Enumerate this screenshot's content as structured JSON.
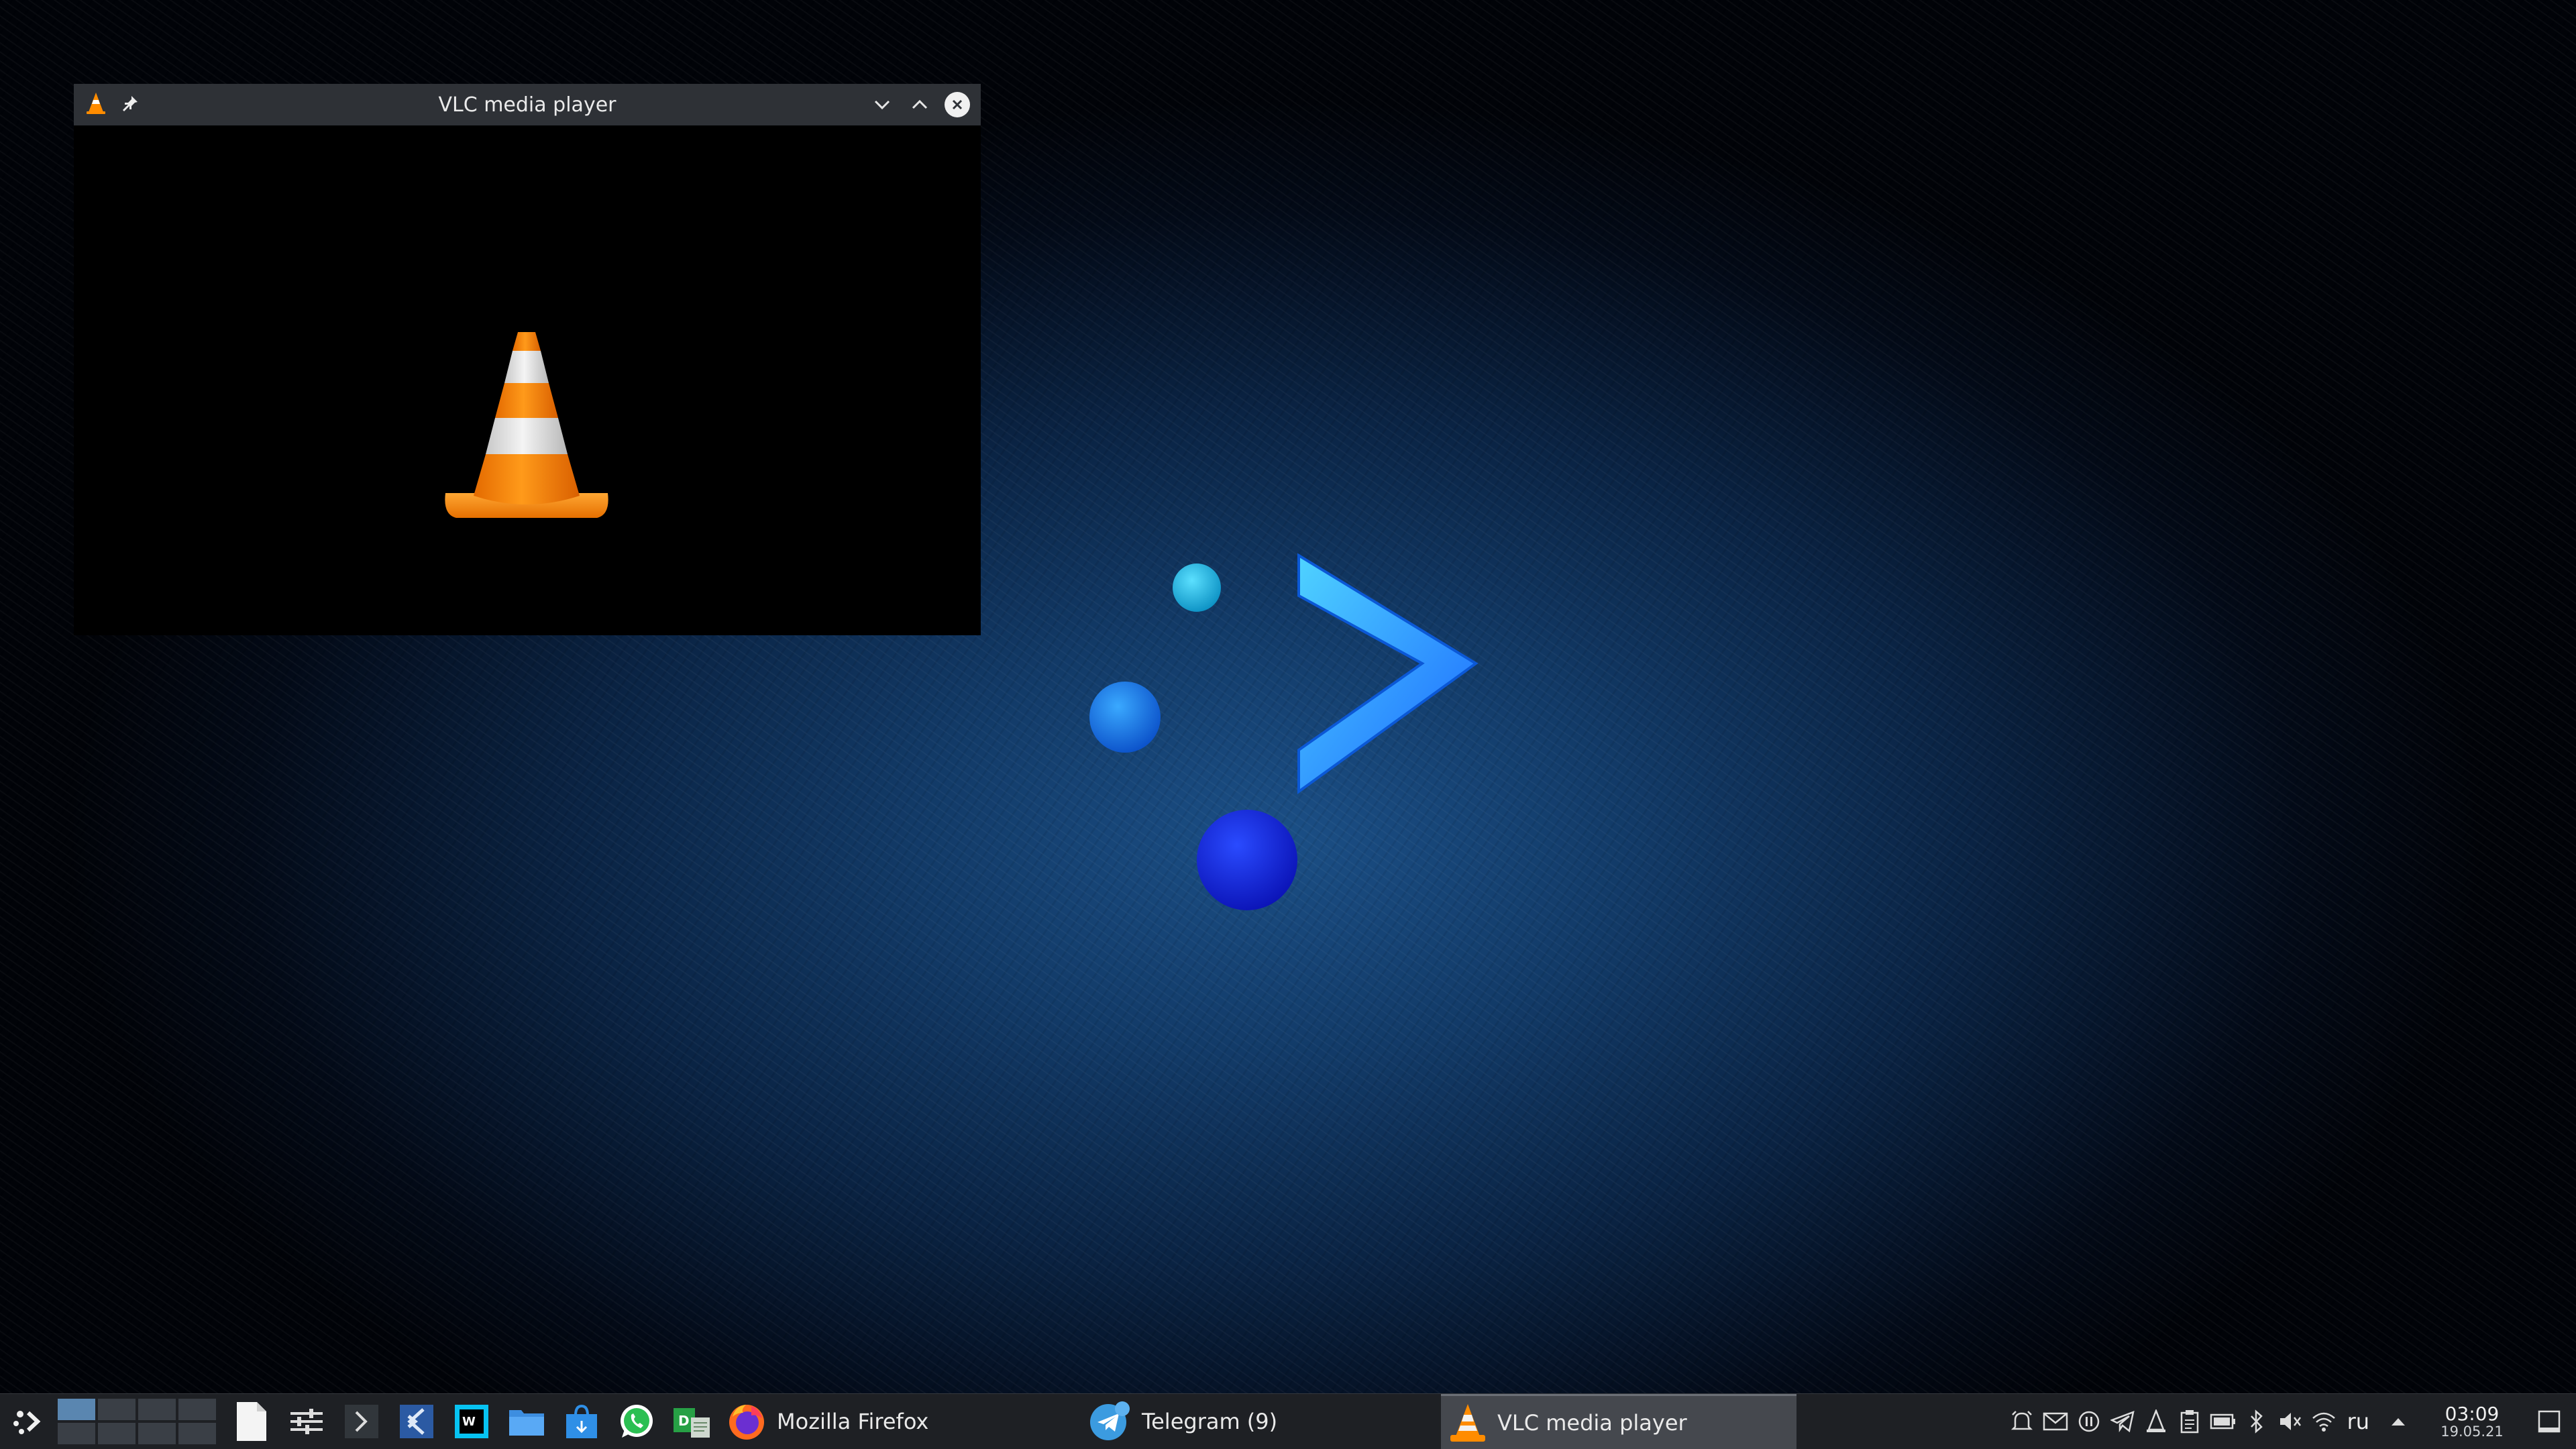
{
  "window": {
    "title": "VLC media player",
    "icons": [
      "vlc-cone-icon",
      "pin-icon"
    ],
    "controls": [
      "minimize-chevron-icon",
      "maximize-chevron-icon",
      "close-icon"
    ]
  },
  "taskbar": {
    "launcher_icon": "kde-launcher-icon",
    "pinned_apps": [
      "file-icon",
      "settings-sliders-icon",
      "terminal-icon",
      "vscode-icon",
      "webstorm-icon",
      "file-manager-icon",
      "store-icon",
      "whatsapp-icon",
      "document-app-icon"
    ],
    "tasks": [
      {
        "label": "Mozilla Firefox",
        "icon": "firefox-icon",
        "active": false
      },
      {
        "label": "Telegram (9)",
        "icon": "telegram-icon",
        "active": false
      },
      {
        "label": "VLC media player",
        "icon": "vlc-cone-icon",
        "active": true
      }
    ],
    "tray_icons": [
      "alarm-icon",
      "mail-icon",
      "pause-icon",
      "telegram-tray-icon",
      "vlc-tray-icon",
      "clipboard-icon",
      "battery-icon",
      "bluetooth-icon",
      "volume-muted-icon",
      "wifi-icon"
    ],
    "language": "ru",
    "expand_icon": "caret-up-icon",
    "clock": {
      "time": "03:09",
      "date": "19.05.21"
    },
    "show_desktop_icon": "show-desktop-icon"
  }
}
